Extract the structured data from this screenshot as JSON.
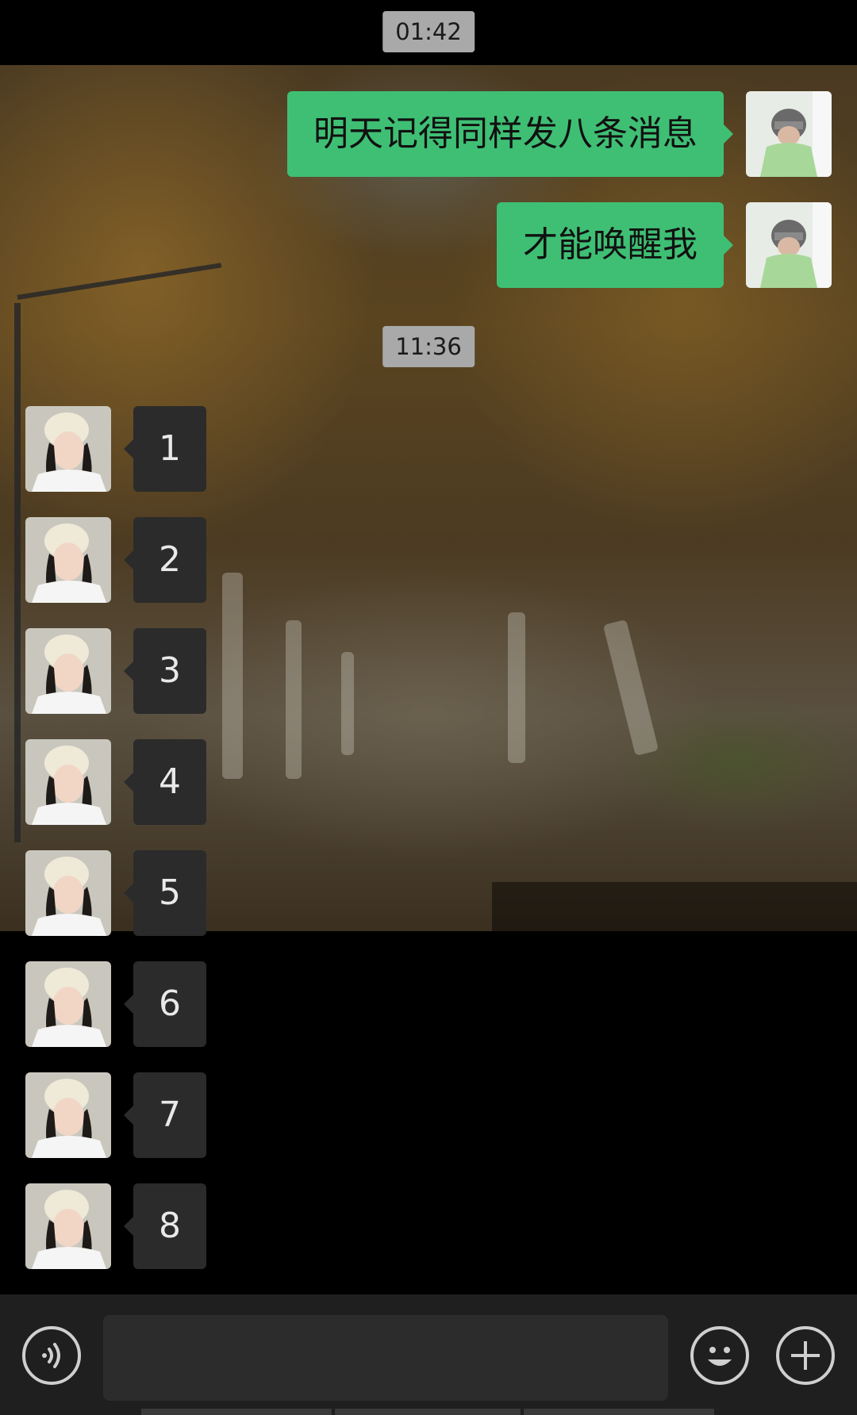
{
  "timestamps": [
    "01:42",
    "11:36"
  ],
  "outgoing_messages": [
    {
      "text": "明天记得同样发八条消息"
    },
    {
      "text": "才能唤醒我"
    }
  ],
  "incoming_messages": [
    {
      "text": "1"
    },
    {
      "text": "2"
    },
    {
      "text": "3"
    },
    {
      "text": "4"
    },
    {
      "text": "5"
    },
    {
      "text": "6"
    },
    {
      "text": "7"
    },
    {
      "text": "8"
    }
  ],
  "input_bar": {
    "voice_icon": "voice-icon",
    "emoji_icon": "emoji-icon",
    "more_icon": "plus-icon",
    "input_value": ""
  },
  "colors": {
    "outgoing_bubble": "#3fbf74",
    "incoming_bubble": "#2b2b2b",
    "timestamp_bg": "#a9a9a9"
  }
}
